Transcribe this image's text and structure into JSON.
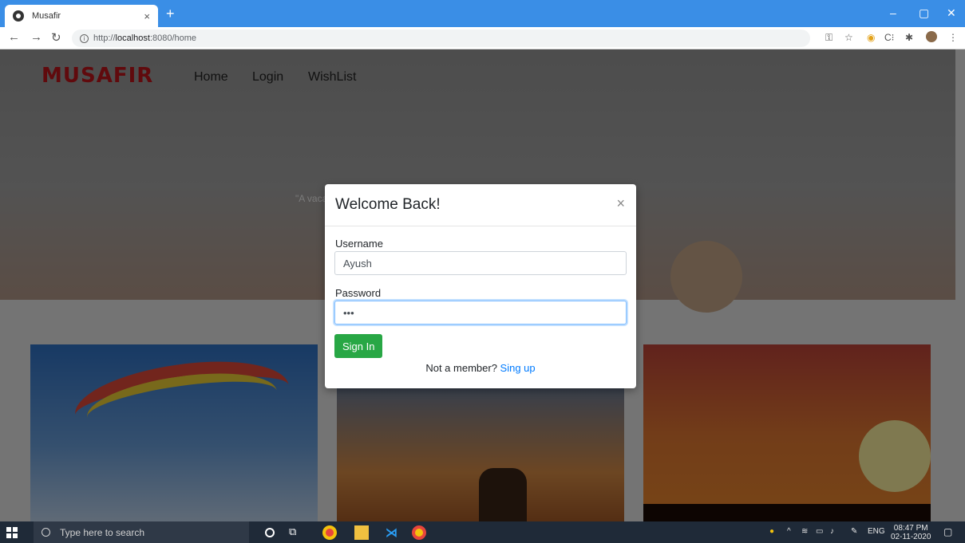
{
  "browser": {
    "tab_title": "Musafir",
    "tab_close": "×",
    "new_tab": "+",
    "url_prefix": "http://",
    "url_host": "localhost",
    "url_rest": ":8080/home",
    "window_controls": [
      "–",
      "▢",
      "✕"
    ]
  },
  "site": {
    "logo": "MUSAFIR",
    "nav": [
      "Home",
      "Login",
      "WishList"
    ],
    "hero_quote": "\"A vaca"
  },
  "modal": {
    "title": "Welcome Back!",
    "close": "×",
    "username_label": "Username",
    "username_value": "Ayush",
    "password_label": "Password",
    "password_value": "•••",
    "signin_label": "Sign In",
    "member_text": "Not a member? ",
    "signup_link": "Sing up"
  },
  "taskbar": {
    "search_placeholder": "Type here to search",
    "language": "ENG",
    "time": "08:47 PM",
    "date": "02-11-2020"
  },
  "colors": {
    "brand": "#c0151b",
    "success": "#28a745",
    "link": "#007bff",
    "chrome_blue": "#3a8ee6"
  }
}
